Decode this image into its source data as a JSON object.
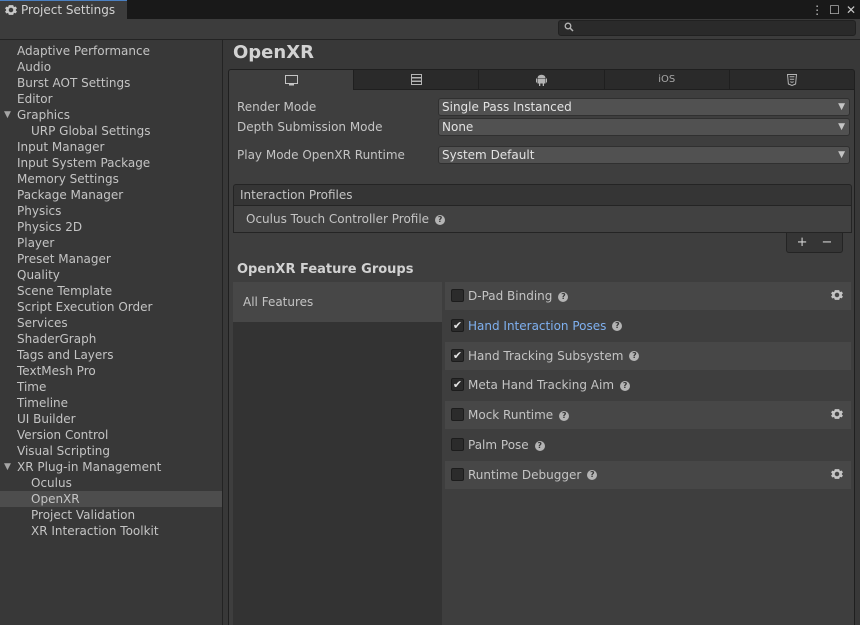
{
  "window": {
    "tab_title": "Project Settings",
    "icon": "gear-icon",
    "controls": {
      "menu": "⋮",
      "maximize": "☐",
      "close": "✕"
    }
  },
  "search": {
    "placeholder": "",
    "icon": "search-icon"
  },
  "sidebar": {
    "items": [
      {
        "label": "Adaptive Performance",
        "indent": 0
      },
      {
        "label": "Audio",
        "indent": 0
      },
      {
        "label": "Burst AOT Settings",
        "indent": 0
      },
      {
        "label": "Editor",
        "indent": 0
      },
      {
        "label": "Graphics",
        "indent": 0,
        "expanded": true
      },
      {
        "label": "URP Global Settings",
        "indent": 1
      },
      {
        "label": "Input Manager",
        "indent": 0
      },
      {
        "label": "Input System Package",
        "indent": 0
      },
      {
        "label": "Memory Settings",
        "indent": 0
      },
      {
        "label": "Package Manager",
        "indent": 0
      },
      {
        "label": "Physics",
        "indent": 0
      },
      {
        "label": "Physics 2D",
        "indent": 0
      },
      {
        "label": "Player",
        "indent": 0
      },
      {
        "label": "Preset Manager",
        "indent": 0
      },
      {
        "label": "Quality",
        "indent": 0
      },
      {
        "label": "Scene Template",
        "indent": 0
      },
      {
        "label": "Script Execution Order",
        "indent": 0
      },
      {
        "label": "Services",
        "indent": 0
      },
      {
        "label": "ShaderGraph",
        "indent": 0
      },
      {
        "label": "Tags and Layers",
        "indent": 0
      },
      {
        "label": "TextMesh Pro",
        "indent": 0
      },
      {
        "label": "Time",
        "indent": 0
      },
      {
        "label": "Timeline",
        "indent": 0
      },
      {
        "label": "UI Builder",
        "indent": 0
      },
      {
        "label": "Version Control",
        "indent": 0
      },
      {
        "label": "Visual Scripting",
        "indent": 0
      },
      {
        "label": "XR Plug-in Management",
        "indent": 0,
        "expanded": true
      },
      {
        "label": "Oculus",
        "indent": 1
      },
      {
        "label": "OpenXR",
        "indent": 1,
        "selected": true
      },
      {
        "label": "Project Validation",
        "indent": 1
      },
      {
        "label": "XR Interaction Toolkit",
        "indent": 1
      }
    ]
  },
  "main": {
    "title": "OpenXR",
    "platform_tabs": [
      {
        "icon": "monitor-icon",
        "label": ""
      },
      {
        "icon": "server-icon",
        "label": ""
      },
      {
        "icon": "android-icon",
        "label": ""
      },
      {
        "icon": "",
        "label": "iOS"
      },
      {
        "icon": "html5-icon",
        "label": ""
      }
    ],
    "properties": {
      "render_mode": {
        "label": "Render Mode",
        "value": "Single Pass Instanced"
      },
      "depth_submission": {
        "label": "Depth Submission Mode",
        "value": "None"
      },
      "play_mode_runtime": {
        "label": "Play Mode OpenXR Runtime",
        "value": "System Default"
      }
    },
    "interaction_profiles": {
      "header": "Interaction Profiles",
      "item": "Oculus Touch Controller Profile",
      "add": "+",
      "remove": "−"
    },
    "feature_groups": {
      "title": "OpenXR Feature Groups",
      "groups": [
        "All Features"
      ],
      "features": [
        {
          "label": "D-Pad Binding",
          "checked": false,
          "gear": true,
          "highlight": false
        },
        {
          "label": "Hand Interaction Poses",
          "checked": true,
          "gear": false,
          "highlight": true
        },
        {
          "label": "Hand Tracking Subsystem",
          "checked": true,
          "gear": false,
          "highlight": false
        },
        {
          "label": "Meta Hand Tracking Aim",
          "checked": true,
          "gear": false,
          "highlight": false
        },
        {
          "label": "Mock Runtime",
          "checked": false,
          "gear": true,
          "highlight": false
        },
        {
          "label": "Palm Pose",
          "checked": false,
          "gear": false,
          "highlight": false
        },
        {
          "label": "Runtime Debugger",
          "checked": false,
          "gear": true,
          "highlight": false
        }
      ]
    },
    "help_glyph": "?",
    "check_glyph": "✔",
    "dropdown_arrow": "▼"
  }
}
